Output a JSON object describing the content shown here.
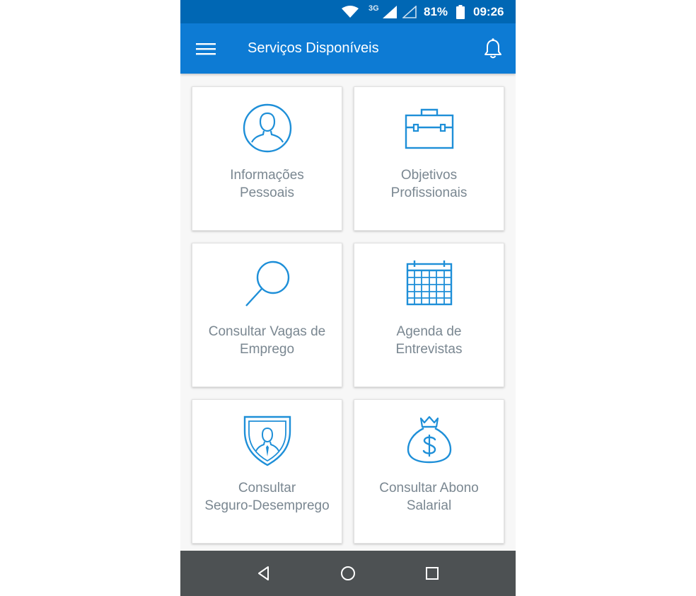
{
  "status_bar": {
    "network": "3G",
    "battery_percent": "81%",
    "time": "09:26"
  },
  "app_bar": {
    "title": "Serviços Disponíveis",
    "menu_icon": "hamburger-menu-icon",
    "notification_icon": "bell-icon"
  },
  "colors": {
    "status_bar": "#0067b4",
    "app_bar": "#0d7bd4",
    "icon_blue": "#1e8fd8",
    "label_gray": "#7a8791",
    "nav_bar": "#4d5153"
  },
  "services": [
    {
      "line1": "Informações",
      "line2": "Pessoais",
      "icon": "person-icon"
    },
    {
      "line1": "Objetivos",
      "line2": "Profissionais",
      "icon": "briefcase-icon"
    },
    {
      "line1": "Consultar Vagas de",
      "line2": "Emprego",
      "icon": "search-icon"
    },
    {
      "line1": "Agenda de",
      "line2": "Entrevistas",
      "icon": "calendar-icon"
    },
    {
      "line1": "Consultar",
      "line2": "Seguro-Desemprego",
      "icon": "shield-person-icon"
    },
    {
      "line1": "Consultar Abono",
      "line2": "Salarial",
      "icon": "money-bag-icon"
    }
  ],
  "nav_bar": {
    "back_icon": "back-triangle-icon",
    "home_icon": "home-circle-icon",
    "recent_icon": "recent-apps-icon"
  }
}
